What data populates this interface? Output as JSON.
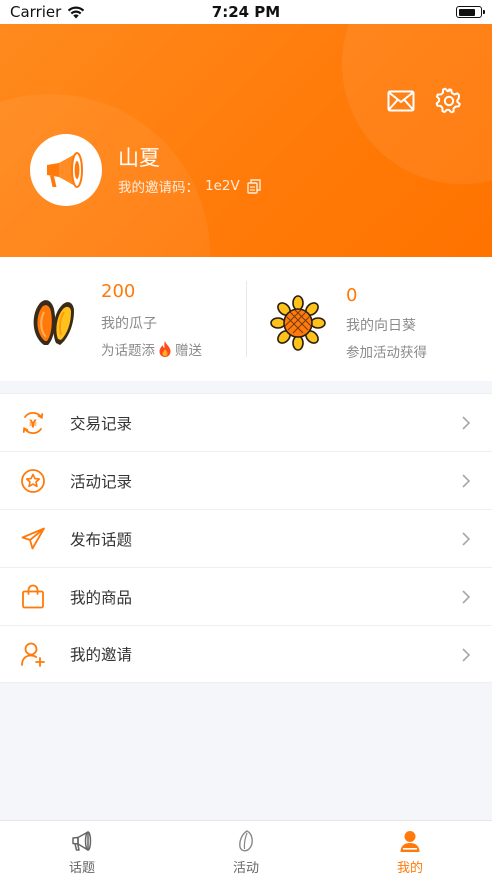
{
  "status_bar": {
    "carrier": "Carrier",
    "time": "7:24 PM"
  },
  "header": {
    "username": "山夏",
    "invite_label": "我的邀请码：",
    "invite_code": "1e2V",
    "icons": [
      "mail-icon",
      "settings-gear-icon"
    ]
  },
  "stats": {
    "seeds": {
      "value": "200",
      "title": "我的瓜子",
      "sub_prefix": "为话题添",
      "sub_suffix": "赠送",
      "icon": "sunflower-seed-icon"
    },
    "sunflowers": {
      "value": "0",
      "title": "我的向日葵",
      "sub": "参加活动获得",
      "icon": "sunflower-icon"
    }
  },
  "menu": [
    {
      "label": "交易记录",
      "icon": "transaction-yen-icon"
    },
    {
      "label": "活动记录",
      "icon": "activity-star-icon"
    },
    {
      "label": "发布话题",
      "icon": "send-paper-plane-icon"
    },
    {
      "label": "我的商品",
      "icon": "shopping-bag-icon"
    },
    {
      "label": "我的邀请",
      "icon": "invite-user-icon"
    }
  ],
  "tabbar": [
    {
      "label": "话题",
      "icon": "megaphone-icon",
      "active": false
    },
    {
      "label": "活动",
      "icon": "seed-icon",
      "active": false
    },
    {
      "label": "我的",
      "icon": "user-icon",
      "active": true
    }
  ],
  "colors": {
    "accent": "#ff7a0a",
    "header_start": "#ff8a1e",
    "header_end": "#ff7300",
    "text": "#333333",
    "muted": "#8a8a8a"
  }
}
